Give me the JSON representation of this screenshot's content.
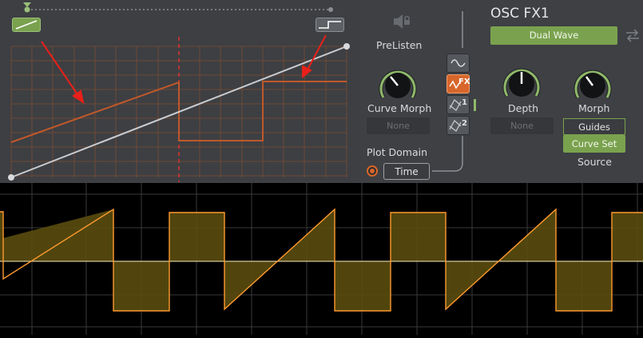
{
  "header": {
    "title": "OSC FX1",
    "mode_label": "Dual Wave"
  },
  "labels": {
    "prelisten": "PreListen",
    "curve_morph": "Curve Morph",
    "depth": "Depth",
    "morph": "Morph",
    "plot_domain": "Plot Domain",
    "source": "Source"
  },
  "fields": {
    "curve_morph_value": "None",
    "depth_value": "None",
    "plot_domain_value": "Time"
  },
  "side_buttons": {
    "fx_label": "FX",
    "one_label": "1",
    "two_label": "2"
  },
  "source_options": [
    "Guides",
    "Curve Set"
  ],
  "source_selected": "Curve Set",
  "colors": {
    "accent_green": "#7aa24e",
    "curve_orange": "#c0582a",
    "fx_orange": "#d8662a",
    "scope_orange": "#ff9a2e",
    "scope_fill": "#5a4d0e"
  },
  "icons": {
    "speaker": "speaker-lock-icon",
    "swap": "swap-arrows-icon"
  },
  "knob_levels": {
    "curve_morph": 0.5,
    "depth": 0.5,
    "morph": 0.35
  }
}
